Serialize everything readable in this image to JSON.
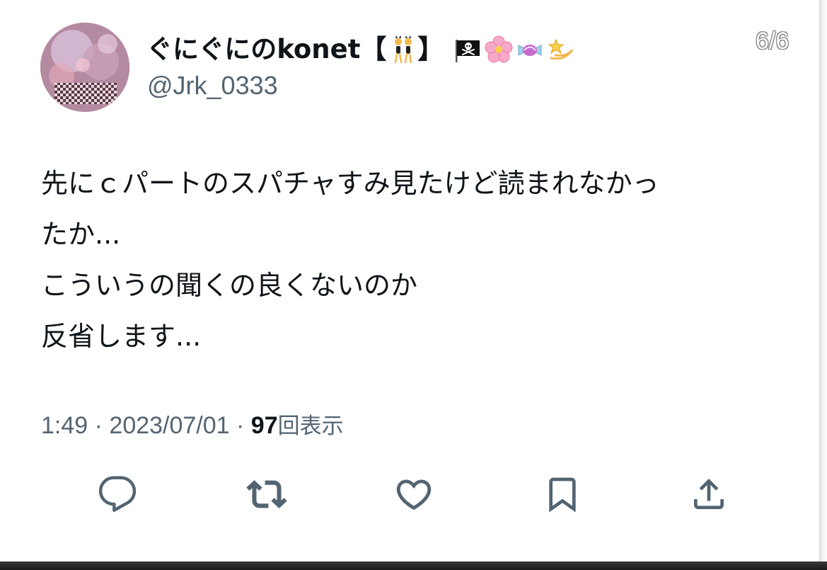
{
  "tweet": {
    "author": {
      "display_name": "ぐにぐにのkonet【👯‍♀️】🏴‍☠️🌸🍬💫",
      "display_name_text": "ぐにぐにのkonet【",
      "display_name_close": "】",
      "handle": "@Jrk_0333"
    },
    "page_indicator": "6/6",
    "text_lines": [
      "先にｃパートのスパチャすみ見たけど読まれなかっ",
      "たか...",
      "こういうの聞くの良くないのか",
      "反省します..."
    ],
    "meta": {
      "time": "1:49",
      "separator": " · ",
      "date": "2023/07/01",
      "views_count": "97",
      "views_label": "回表示"
    },
    "actions": [
      {
        "name": "reply",
        "icon": "comment-icon"
      },
      {
        "name": "retweet",
        "icon": "retweet-icon"
      },
      {
        "name": "like",
        "icon": "heart-icon"
      },
      {
        "name": "bookmark",
        "icon": "bookmark-icon"
      },
      {
        "name": "share",
        "icon": "share-icon"
      }
    ],
    "colors": {
      "text": "#0f1419",
      "secondary": "#536471"
    }
  }
}
